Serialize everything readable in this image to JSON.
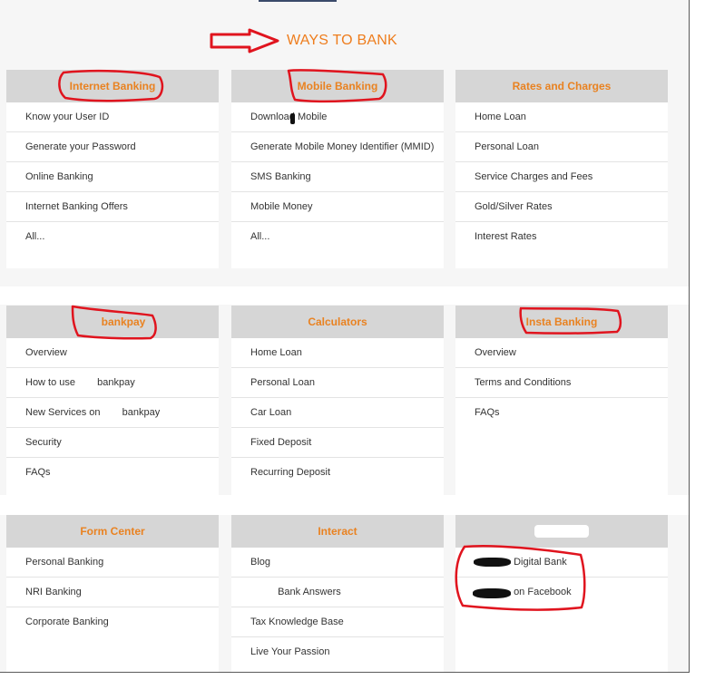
{
  "heading": "WAYS TO BANK",
  "colors": {
    "accent": "#ee7d1d",
    "header_bg": "#d6d6d6",
    "annotation": "#e0141e"
  },
  "cards": {
    "internet": {
      "title": "Internet Banking",
      "items": [
        "Know your User ID",
        "Generate your Password",
        "Online Banking",
        "Internet Banking Offers",
        "All..."
      ]
    },
    "mobile": {
      "title": "Mobile Banking",
      "items": [
        "Download Mobile",
        "Generate Mobile Money Identifier (MMID)",
        "SMS Banking",
        "Mobile Money",
        "All..."
      ]
    },
    "rates": {
      "title": "Rates and Charges",
      "items": [
        "Home Loan",
        "Personal Loan",
        "Service Charges and Fees",
        "Gold/Silver Rates",
        "Interest Rates"
      ]
    },
    "bankpay": {
      "title": "bankpay",
      "items": [
        "Overview",
        "How to use",
        "bankpay",
        "New Services on",
        "bankpay",
        "Security",
        "FAQs"
      ]
    },
    "calculators": {
      "title": "Calculators",
      "items": [
        "Home Loan",
        "Personal Loan",
        "Car Loan",
        "Fixed Deposit",
        "Recurring Deposit"
      ]
    },
    "insta": {
      "title": "Insta Banking",
      "items": [
        "Overview",
        "Terms and Conditions",
        "FAQs"
      ]
    },
    "form": {
      "title": "Form Center",
      "items": [
        "Personal Banking",
        "NRI Banking",
        "Corporate Banking"
      ]
    },
    "interact": {
      "title": "Interact",
      "items": [
        "Blog",
        "Bank Answers",
        "Tax Knowledge Base",
        "Live Your Passion"
      ]
    },
    "social": {
      "title": "",
      "items": [
        "Digital Bank",
        "on Facebook"
      ]
    }
  }
}
